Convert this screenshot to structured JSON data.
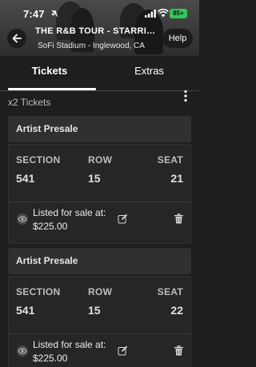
{
  "status_bar": {
    "time": "7:47",
    "battery": "85+"
  },
  "header": {
    "title": "THE R&B TOUR - STARRING...",
    "subtitle": "SoFi Stadium - Inglewood, CA",
    "help_label": "Help"
  },
  "tabs": [
    {
      "label": "Tickets"
    },
    {
      "label": "Extras"
    }
  ],
  "active_tab": "Tickets",
  "ticket_count": "x2 Tickets",
  "column_labels": {
    "section": "SECTION",
    "row": "ROW",
    "seat": "SEAT"
  },
  "tickets": [
    {
      "group": "Artist Presale",
      "section": "541",
      "row": "15",
      "seat": "21",
      "listed_label": "Listed for sale at:",
      "price": "$225.00"
    },
    {
      "group": "Artist Presale",
      "section": "541",
      "row": "15",
      "seat": "22",
      "listed_label": "Listed for sale at:",
      "price": "$225.00"
    }
  ],
  "icons": {
    "back": "arrow-left-icon",
    "bell": "bell-slash-icon",
    "signal": "signal-icon",
    "wifi": "wifi-icon",
    "more": "more-vertical-icon",
    "eye": "eye-icon",
    "edit": "edit-icon",
    "trash": "trash-icon"
  },
  "colors": {
    "background": "#1e1e1e",
    "card_header": "#303030",
    "card_body": "#262626",
    "battery": "#34c759"
  }
}
